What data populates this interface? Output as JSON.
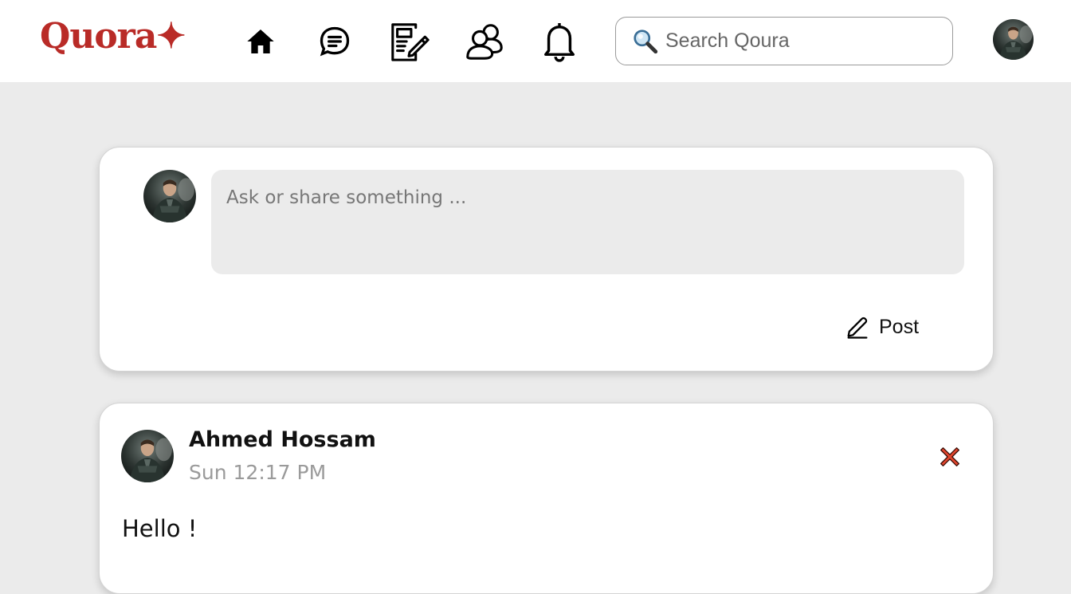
{
  "navbar": {
    "logo_text": "Quora✦",
    "nav_icons": [
      "home-icon",
      "answers-icon",
      "write-icon",
      "spaces-icon",
      "notifications-icon"
    ],
    "search": {
      "placeholder": "Search Qoura",
      "value": ""
    },
    "profile_icon": "user-avatar-icon"
  },
  "composer": {
    "placeholder": "Ask or share something ...",
    "value": "",
    "post_button_label": "Post"
  },
  "posts": [
    {
      "author": "Ahmed Hossam",
      "time": "Sun 12:17 PM",
      "body": "Hello !",
      "delete_icon": "close-icon"
    }
  ],
  "colors": {
    "brand": "#b92b27",
    "page_background": "#ebebeb",
    "delete_red": "#e0452d"
  }
}
